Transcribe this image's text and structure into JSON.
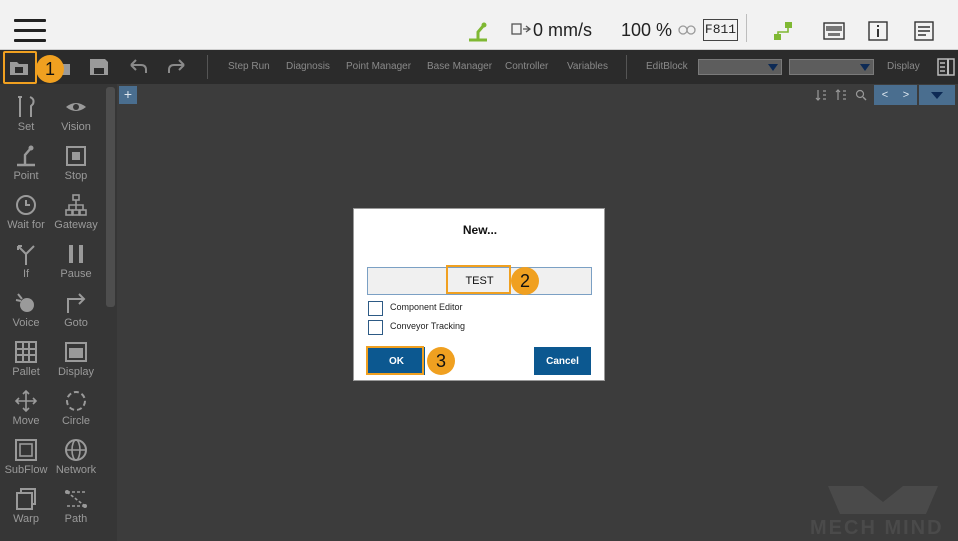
{
  "status_bar": {
    "speed": "0 mm/s",
    "percent": "100 %",
    "code": "F811"
  },
  "toolbar": {
    "menu": [
      "Step Run",
      "Diagnosis",
      "Point Manager",
      "Base Manager",
      "Controller",
      "Variables"
    ],
    "edit_block": "EditBlock",
    "display": "Display"
  },
  "sidebar": {
    "items": [
      {
        "label": "Set",
        "icon": "set-icon"
      },
      {
        "label": "Vision",
        "icon": "vision-icon"
      },
      {
        "label": "Point",
        "icon": "point-icon"
      },
      {
        "label": "Stop",
        "icon": "stop-icon"
      },
      {
        "label": "Wait for",
        "icon": "wait-for-icon"
      },
      {
        "label": "Gateway",
        "icon": "gateway-icon"
      },
      {
        "label": "If",
        "icon": "if-icon"
      },
      {
        "label": "Pause",
        "icon": "pause-icon"
      },
      {
        "label": "Voice",
        "icon": "voice-icon"
      },
      {
        "label": "Goto",
        "icon": "goto-icon"
      },
      {
        "label": "Pallet",
        "icon": "pallet-icon"
      },
      {
        "label": "Display",
        "icon": "display-icon"
      },
      {
        "label": "Move",
        "icon": "move-icon"
      },
      {
        "label": "Circle",
        "icon": "circle-icon"
      },
      {
        "label": "SubFlow",
        "icon": "subflow-icon"
      },
      {
        "label": "Network",
        "icon": "network-icon"
      },
      {
        "label": "Warp",
        "icon": "warp-icon"
      },
      {
        "label": "Path",
        "icon": "path-icon"
      }
    ]
  },
  "main": {
    "add_tab": "+",
    "nav_prev": "<",
    "nav_next": ">"
  },
  "dialog": {
    "title": "New...",
    "name_value": "TEST",
    "checkbox_component_editor": "Component Editor",
    "checkbox_conveyor_tracking": "Conveyor Tracking",
    "ok_label": "OK",
    "cancel_label": "Cancel"
  },
  "badges": [
    "1",
    "2",
    "3"
  ],
  "watermark": "MECH MIND",
  "colors": {
    "accent": "#f0a020",
    "primary_button": "#0c5890",
    "robot_green": "#7fb833"
  }
}
